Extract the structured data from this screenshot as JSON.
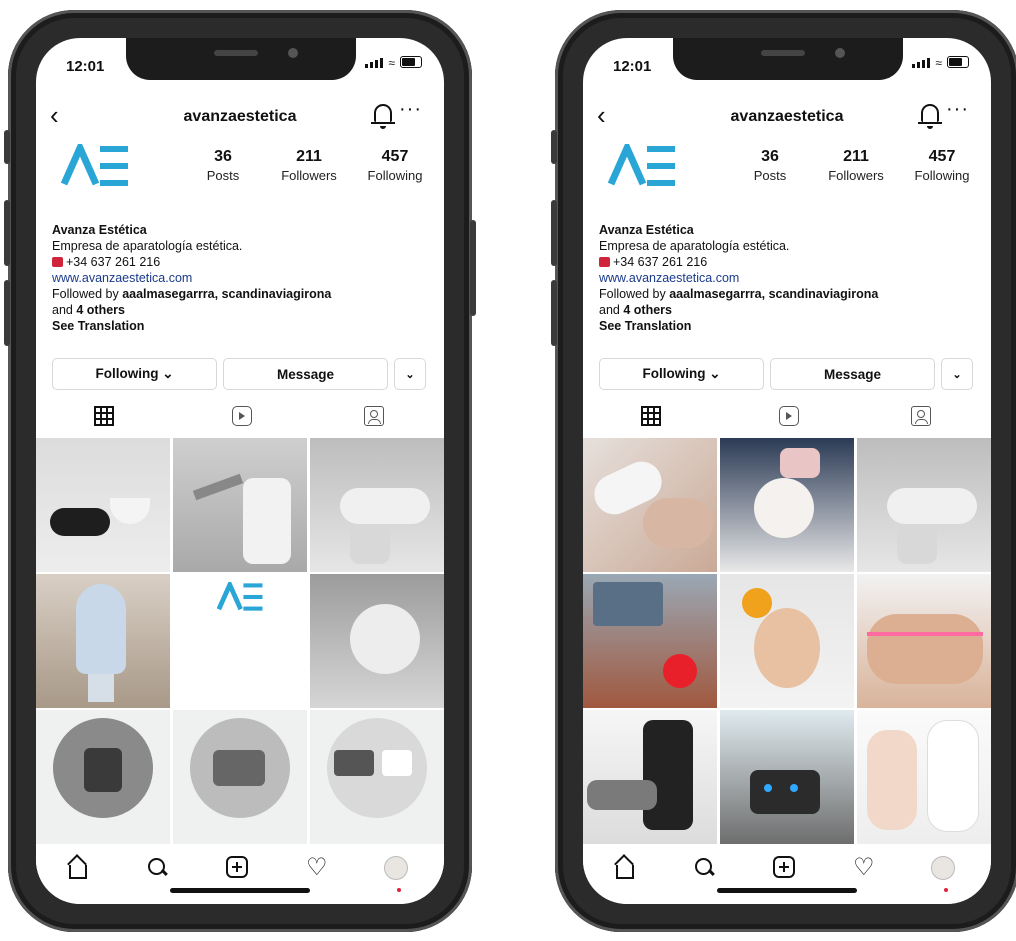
{
  "status_bar": {
    "time": "12:01"
  },
  "profile": {
    "username": "avanzaestetica",
    "stats": [
      {
        "value": "36",
        "label": "Posts"
      },
      {
        "value": "211",
        "label": "Followers"
      },
      {
        "value": "457",
        "label": "Following"
      }
    ],
    "bio": {
      "name": "Avanza Estética",
      "description": "Empresa de aparatología estética.",
      "phone": "+34 637 261 216",
      "website": "www.avanzaestetica.com",
      "followed_by_prefix": "Followed by ",
      "followed_by_users": "aaalmasegarrra, scandinaviagirona",
      "followed_by_and": "and ",
      "followed_by_others": "4 others",
      "see_translation": "See Translation"
    },
    "buttons": {
      "following": "Following ⌄",
      "message": "Message",
      "dropdown": "⌄"
    }
  },
  "icons": [
    "back-icon",
    "bell-icon",
    "more-icon",
    "grid-icon",
    "reels-icon",
    "tagged-icon",
    "home-icon",
    "search-icon",
    "add-icon",
    "heart-icon",
    "profile-avatar"
  ],
  "colors": {
    "brand": "#2aa6d6",
    "link": "#1a3a8a",
    "phone_icon": "#d0243a"
  }
}
